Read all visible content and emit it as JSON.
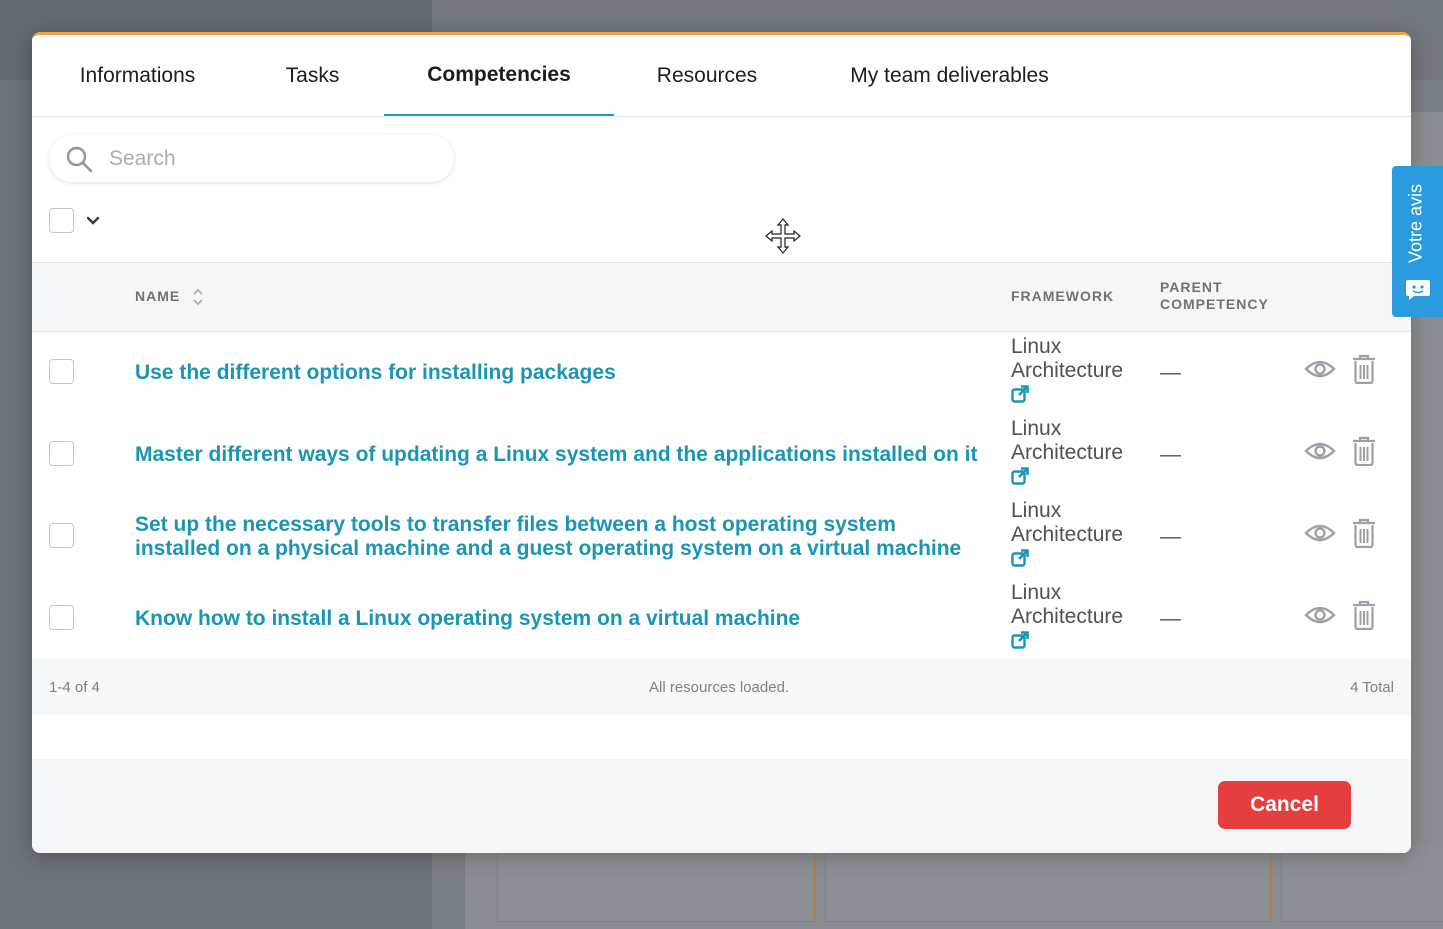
{
  "tabs": [
    {
      "label": "Informations"
    },
    {
      "label": "Tasks"
    },
    {
      "label": "Competencies",
      "active": true
    },
    {
      "label": "Resources"
    },
    {
      "label": "My team deliverables"
    }
  ],
  "search": {
    "placeholder": "Search"
  },
  "table": {
    "headers": {
      "name": "NAME",
      "framework": "FRAMEWORK",
      "parent_line1": "PARENT",
      "parent_line2": "COMPETENCY"
    },
    "rows": [
      {
        "name": "Use the different options for installing packages",
        "framework_line1": "Linux",
        "framework_line2": "Architecture",
        "parent": "—"
      },
      {
        "name": "Master different ways of updating a Linux system and the applications installed on it",
        "framework_line1": "Linux",
        "framework_line2": "Architecture",
        "parent": "—"
      },
      {
        "name": "Set up the necessary tools to transfer files between a host operating system installed on a physical machine and a guest operating system on a virtual machine",
        "framework_line1": "Linux",
        "framework_line2": "Architecture",
        "parent": "—"
      },
      {
        "name": "Know how to install a Linux operating system on a virtual machine",
        "framework_line1": "Linux",
        "framework_line2": "Architecture",
        "parent": "—"
      }
    ],
    "footer": {
      "range": "1-4 of 4",
      "status": "All resources loaded.",
      "total": "4 Total"
    }
  },
  "buttons": {
    "cancel": "Cancel"
  },
  "feedback": {
    "label": "Votre avis"
  },
  "colors": {
    "accent": "#1b95b4",
    "tab_underline": "#2499b8",
    "cancel": "#e53e3e",
    "feedback": "#2b9be0",
    "modal_top_border": "#f0a347"
  },
  "icons": [
    "search-icon",
    "chevron-down-icon",
    "move-icon",
    "sort-icon",
    "external-link-icon",
    "eye-icon",
    "trash-icon",
    "feedback-icon"
  ]
}
